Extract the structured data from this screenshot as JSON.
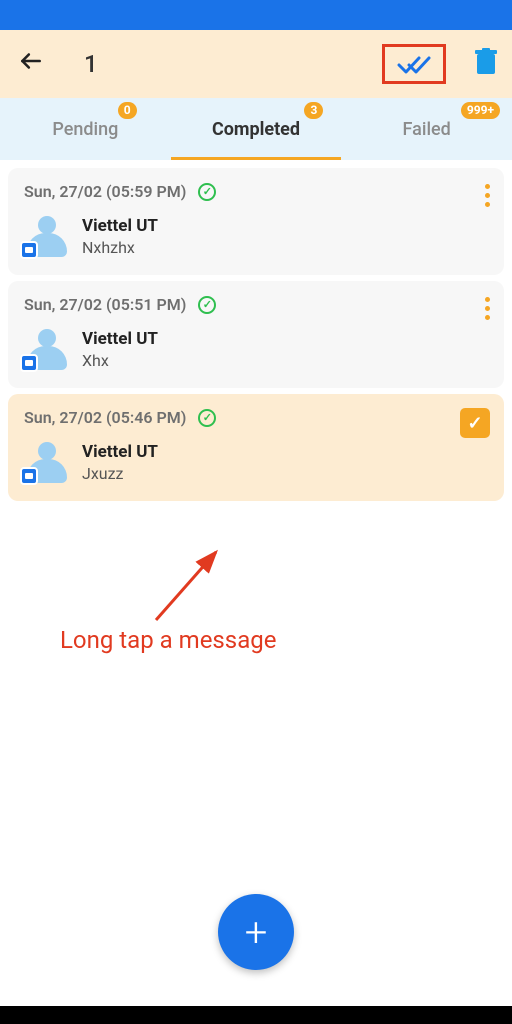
{
  "topbar": {
    "selected_count": "1"
  },
  "tabs": {
    "pending": {
      "label": "Pending",
      "badge": "0"
    },
    "completed": {
      "label": "Completed",
      "badge": "3"
    },
    "failed": {
      "label": "Failed",
      "badge": "999+"
    },
    "active": "completed"
  },
  "messages": [
    {
      "timestamp": "Sun, 27/02 (05:59 PM)",
      "name": "Viettel UT",
      "text": "Nxhzhx",
      "selected": false
    },
    {
      "timestamp": "Sun, 27/02 (05:51 PM)",
      "name": "Viettel UT",
      "text": "Xhx",
      "selected": false
    },
    {
      "timestamp": "Sun, 27/02 (05:46 PM)",
      "name": "Viettel UT",
      "text": "Jxuzz",
      "selected": true
    }
  ],
  "annotation": {
    "text": "Long tap a message"
  },
  "fab": {
    "label": "+"
  }
}
